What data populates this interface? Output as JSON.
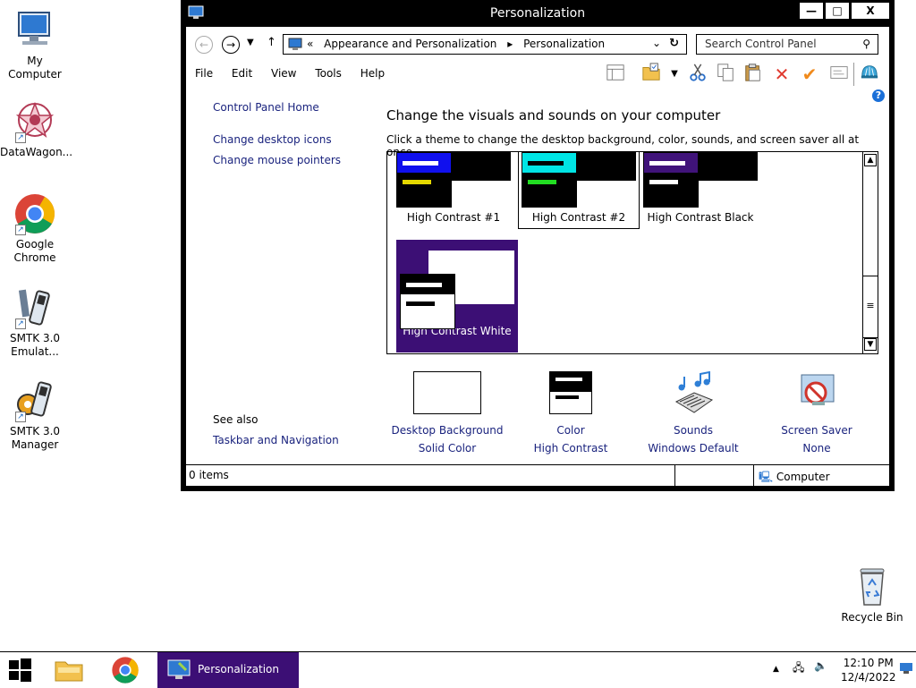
{
  "desktop": {
    "icons": [
      {
        "label": "My Computer",
        "icon": "computer-icon"
      },
      {
        "label": "DataWagon...",
        "icon": "datawagon-icon"
      },
      {
        "label": "Google Chrome",
        "icon": "chrome-icon"
      },
      {
        "label": "SMTK 3.0 Emulat...",
        "icon": "smtk-emulator-icon"
      },
      {
        "label": "SMTK 3.0 Manager",
        "icon": "smtk-manager-icon"
      },
      {
        "label": "Recycle Bin",
        "icon": "recycle-bin-icon"
      }
    ]
  },
  "window": {
    "title": "Personalization",
    "controls": {
      "min": "—",
      "max": "□",
      "close": "X"
    },
    "breadcrumb": {
      "prefix": "«",
      "items": [
        "Appearance and Personalization",
        "Personalization"
      ]
    },
    "search_placeholder": "Search Control Panel",
    "menu": [
      "File",
      "Edit",
      "View",
      "Tools",
      "Help"
    ],
    "left_links": {
      "home": "Control Panel Home",
      "desktop_icons": "Change desktop icons",
      "mouse_pointers": "Change mouse pointers",
      "see_also": "See also",
      "taskbar": "Taskbar and Navigation"
    },
    "heading": "Change the visuals and sounds on your computer",
    "subheading": "Click a theme to change the desktop background, color, sounds, and screen saver all at once.",
    "themes": [
      {
        "name": "High Contrast #1",
        "bar": "#1010ee",
        "l1": "#ffffff",
        "l2": "#e5d800",
        "fill": "#000000",
        "selected": false
      },
      {
        "name": "High Contrast #2",
        "bar": "#00e5e5",
        "l1": "#000000",
        "l2": "#22dd22",
        "fill": "#000000",
        "selected": false
      },
      {
        "name": "High Contrast Black",
        "bar": "#40137a",
        "l1": "#ffffff",
        "l2": "#ffffff",
        "fill": "#000000",
        "selected": false
      },
      {
        "name": "High Contrast White",
        "bar": "#000000",
        "l1": "#ffffff",
        "l2": "#000000",
        "fill": "#ffffff",
        "selected": true
      }
    ],
    "bottom": [
      {
        "title": "Desktop Background",
        "value": "Solid Color"
      },
      {
        "title": "Color",
        "value": "High Contrast"
      },
      {
        "title": "Sounds",
        "value": "Windows Default"
      },
      {
        "title": "Screen Saver",
        "value": "None"
      }
    ],
    "status": {
      "items": "0 items",
      "location": "Computer"
    }
  },
  "taskbar": {
    "active_label": "Personalization",
    "time": "12:10 PM",
    "date": "12/4/2022"
  },
  "colors": {
    "accent": "#3c0f75",
    "link": "#1a237e"
  }
}
